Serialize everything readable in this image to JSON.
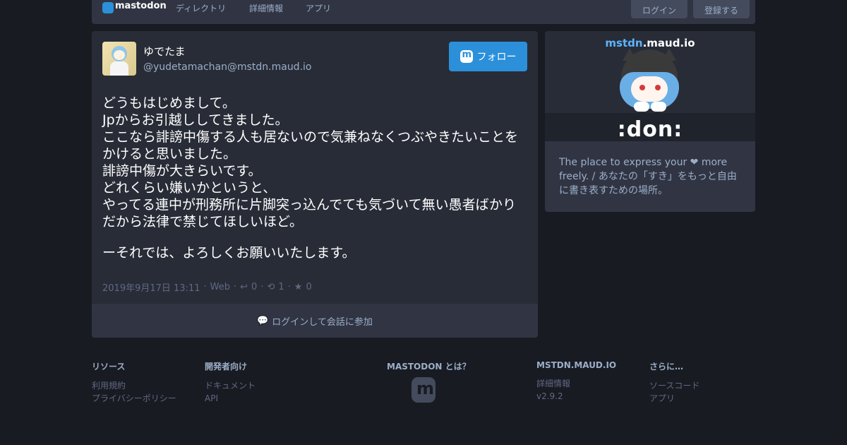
{
  "header": {
    "logo_text": "mastodon",
    "nav": [
      "ディレクトリ",
      "詳細情報",
      "アプリ"
    ],
    "login_label": "ログイン",
    "register_label": "登録する"
  },
  "status": {
    "display_name": "ゆでたま",
    "acct": "@yudetamachan@mstdn.maud.io",
    "follow_label": "フォロー",
    "paragraph1": [
      "どうもはじめまして。",
      "Jpからお引越ししてきました。",
      "ここなら誹謗中傷する人も居ないので気兼ねなくつぶやきたいことをかけると思いました。",
      "誹謗中傷が大きらいです。",
      "どれくらい嫌いかというと、",
      "やってる連中が刑務所に片脚突っ込んでても気づいて無い愚者ばかりだから法律で禁じてほしいほど。"
    ],
    "paragraph2": "ーそれでは、よろしくお願いいたします。",
    "timestamp": "2019年9月17日 13:11",
    "application": "Web",
    "replies": "0",
    "reblogs": "1",
    "favourites": "0",
    "login_prompt": "ログインして会話に参加"
  },
  "instance": {
    "hero_brand_a": "mstdn",
    "hero_brand_b": ".maud.io",
    "hero_caption": ":don:",
    "description": "The place to express your ❤ more freely. / あなたの「すき」をもっと自由に書き表すための場所。"
  },
  "footer": {
    "resources": {
      "heading": "リソース",
      "links": [
        "利用規約",
        "プライバシーポリシー"
      ]
    },
    "developers": {
      "heading": "開発者向け",
      "links": [
        "ドキュメント",
        "API"
      ]
    },
    "about": {
      "heading": "MASTODON とは？"
    },
    "instance": {
      "heading": "MSTDN.MAUD.IO",
      "links": [
        "詳細情報",
        "v2.9.2"
      ]
    },
    "more": {
      "heading": "さらに…",
      "links": [
        "ソースコード",
        "アプリ"
      ]
    }
  },
  "colors": {
    "accent": "#2b90d9",
    "background": "#191b22",
    "card": "#282c37"
  },
  "icons": [
    "mastodon-logo-icon",
    "reply-icon",
    "boost-icon",
    "star-icon",
    "comments-icon"
  ]
}
